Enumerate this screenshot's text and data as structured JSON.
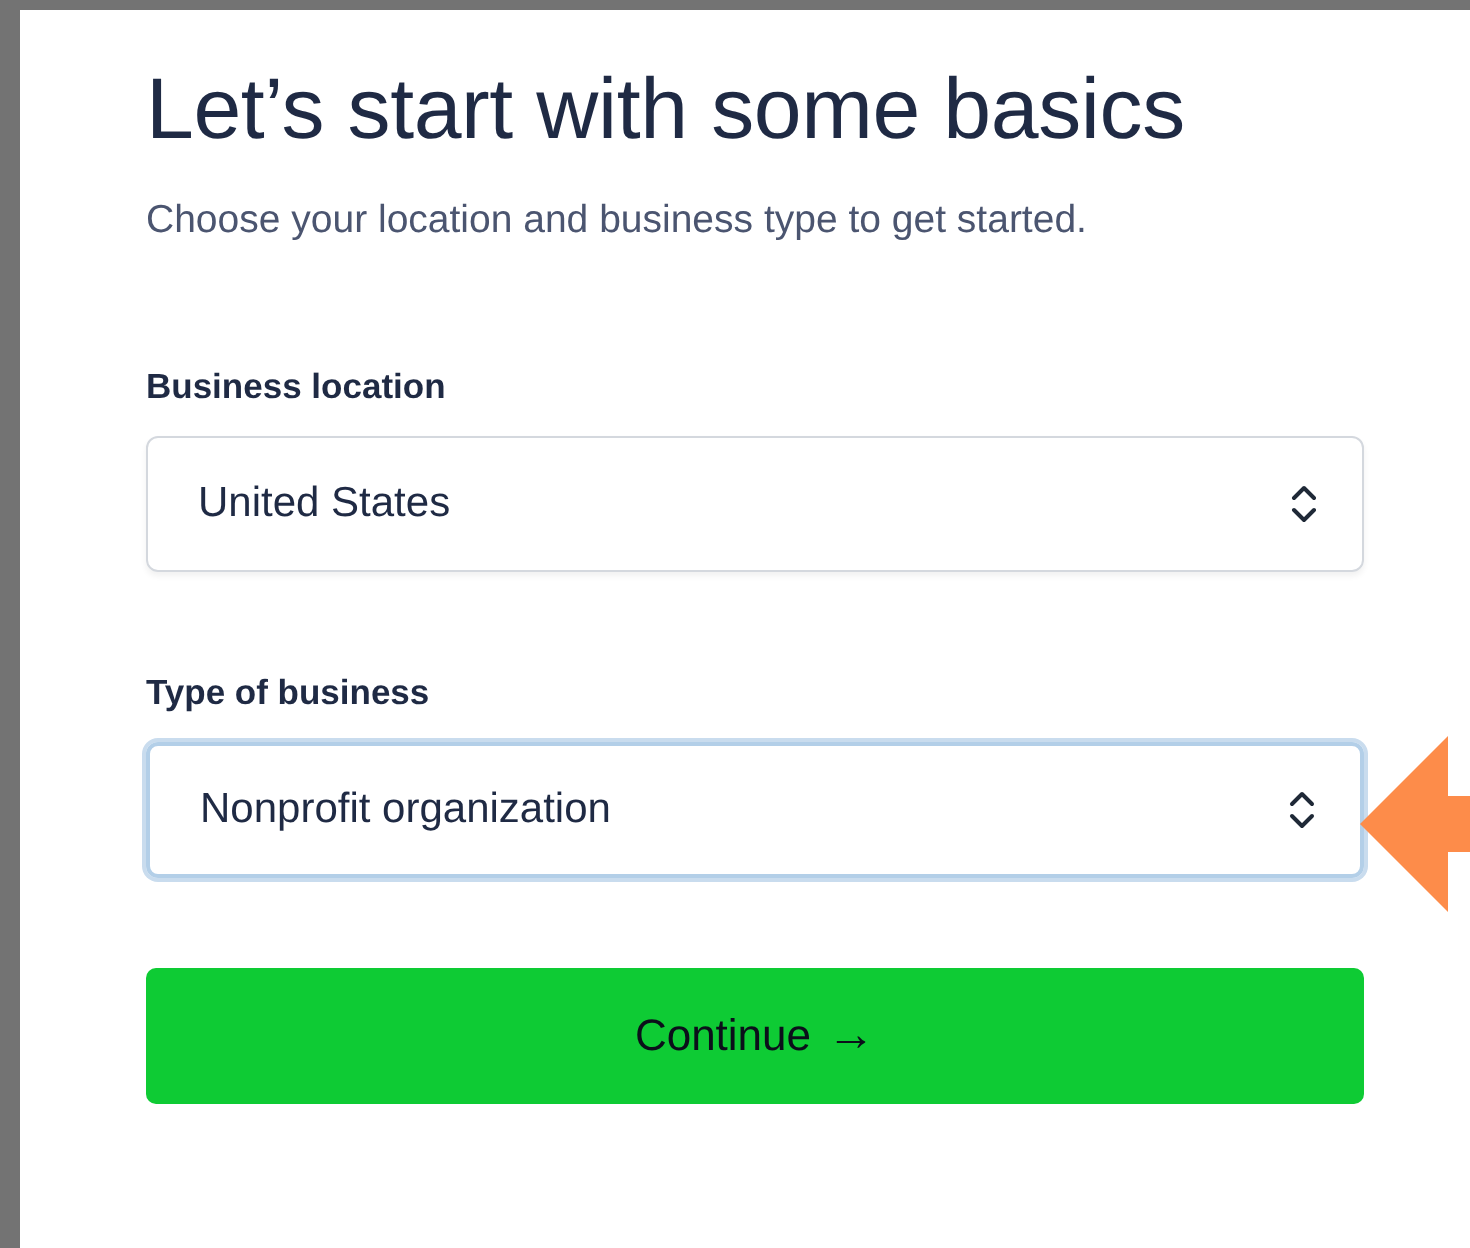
{
  "title": "Let’s start with some basics",
  "subtitle": "Choose your location and business type to get started.",
  "fields": [
    {
      "label": "Business location",
      "value": "United States",
      "focused": false
    },
    {
      "label": "Type of business",
      "value": "Nonprofit organization",
      "focused": true
    }
  ],
  "button": {
    "label": "Continue",
    "arrow": "→"
  }
}
